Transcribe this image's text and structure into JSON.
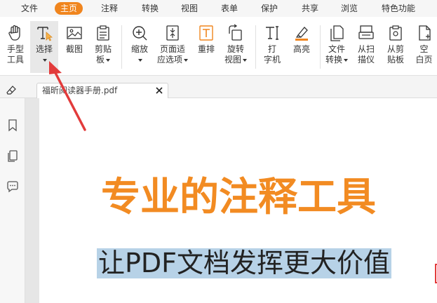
{
  "menubar": {
    "items": [
      "文件",
      "主页",
      "注释",
      "转换",
      "视图",
      "表单",
      "保护",
      "共享",
      "浏览",
      "特色功能"
    ],
    "active": "主页"
  },
  "ribbon": {
    "tools": [
      {
        "id": "hand",
        "line1": "手型",
        "line2": "工具",
        "icon": "hand-icon"
      },
      {
        "id": "select",
        "line1": "选择",
        "line2": "",
        "icon": "text-select-icon"
      },
      {
        "id": "snapshot",
        "line1": "截图",
        "line2": "",
        "icon": "screenshot-icon"
      },
      {
        "id": "clipboard",
        "line1": "剪贴",
        "line2": "板",
        "icon": "clipboard-icon"
      },
      {
        "id": "zoom",
        "line1": "缩放",
        "line2": "",
        "icon": "zoom-icon"
      },
      {
        "id": "fit",
        "line1": "页面适",
        "line2": "应选项",
        "icon": "fit-page-icon"
      },
      {
        "id": "reflow",
        "line1": "重排",
        "line2": "",
        "icon": "reflow-icon"
      },
      {
        "id": "rotate",
        "line1": "旋转",
        "line2": "视图",
        "icon": "rotate-icon"
      },
      {
        "id": "typewriter",
        "line1": "打",
        "line2": "字机",
        "icon": "typewriter-icon"
      },
      {
        "id": "highlight",
        "line1": "高亮",
        "line2": "",
        "icon": "highlight-icon"
      },
      {
        "id": "convert",
        "line1": "文件",
        "line2": "转换",
        "icon": "file-convert-icon"
      },
      {
        "id": "scan",
        "line1": "从扫",
        "line2": "描仪",
        "icon": "scanner-icon"
      },
      {
        "id": "fromclip",
        "line1": "从剪",
        "line2": "贴板",
        "icon": "from-clipboard-icon"
      },
      {
        "id": "blank",
        "line1": "空",
        "line2": "白页",
        "icon": "blank-page-icon"
      }
    ]
  },
  "tab": {
    "title": "福昕阅读器手册.pdf"
  },
  "document": {
    "heading": "专业的注释工具",
    "subline": "让PDF文档发挥更大价值"
  },
  "colors": {
    "accent": "#f0851e",
    "heading": "#f28b22",
    "selection": "#b7d2e7",
    "annotation_arrow": "#e23b3b"
  }
}
